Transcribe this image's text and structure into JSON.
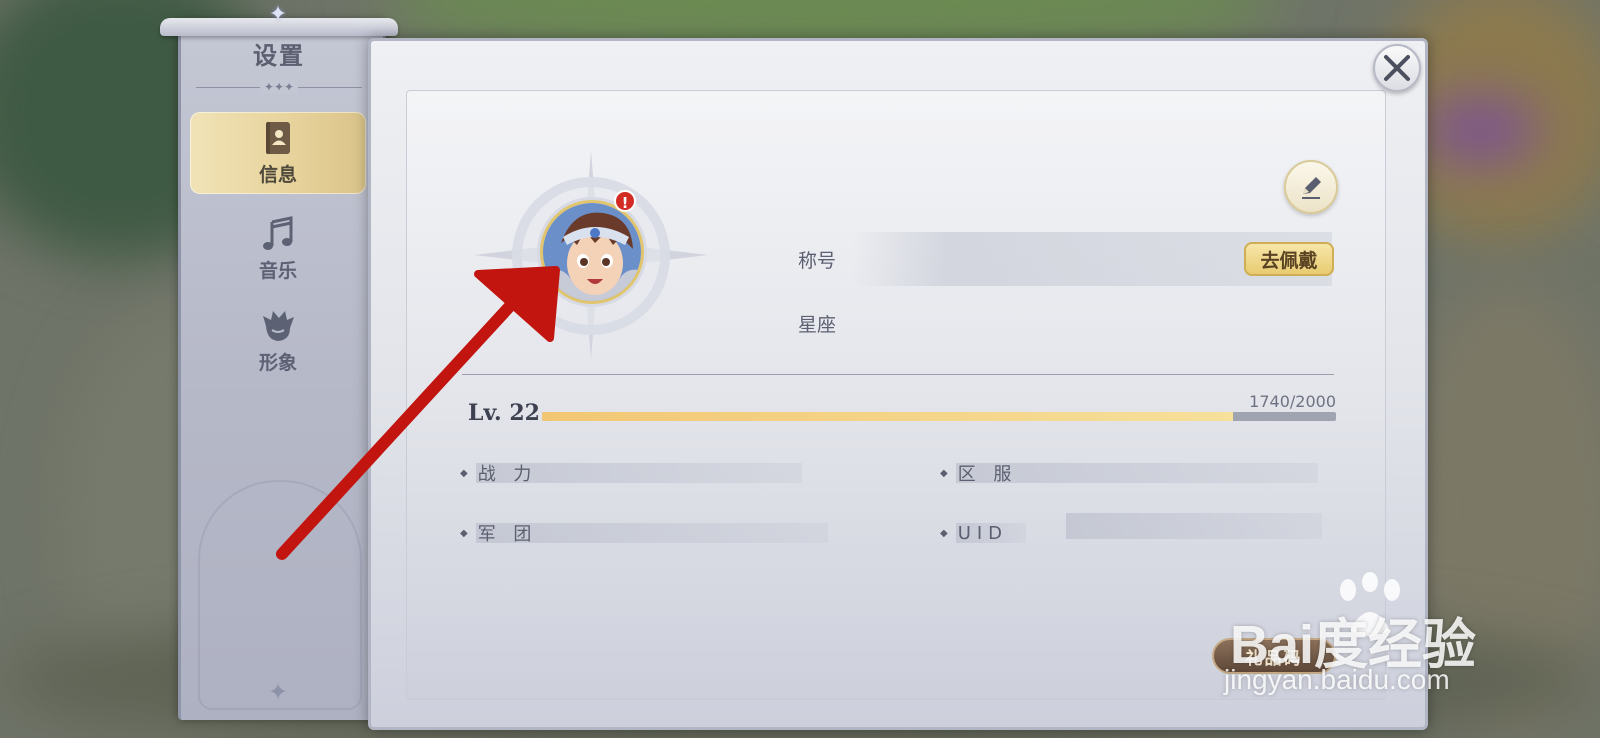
{
  "sidebar": {
    "title": "设置",
    "items": [
      {
        "label": "信息",
        "icon": "contact-book-icon",
        "active": true
      },
      {
        "label": "音乐",
        "icon": "music-note-icon",
        "active": false
      },
      {
        "label": "形象",
        "icon": "character-head-icon",
        "active": false
      }
    ]
  },
  "profile": {
    "title_label": "称号",
    "wear_button": "去佩戴",
    "constellation_label": "星座",
    "level_label": "Lv. 22",
    "exp_text": "1740/2000",
    "exp_progress": 0.87,
    "stats": [
      {
        "label": "战 力"
      },
      {
        "label": "区 服"
      },
      {
        "label": "军 团"
      },
      {
        "label": "UID"
      }
    ],
    "gift_code_button": "礼品码"
  },
  "watermark": {
    "brand": "Bai度经验",
    "url": "jingyan.baidu.com"
  },
  "colors": {
    "accent_gold": "#e8cc72",
    "annotation_arrow": "#c2150f",
    "badge_red": "#d22b24",
    "exp_fill": "#f2c774"
  }
}
